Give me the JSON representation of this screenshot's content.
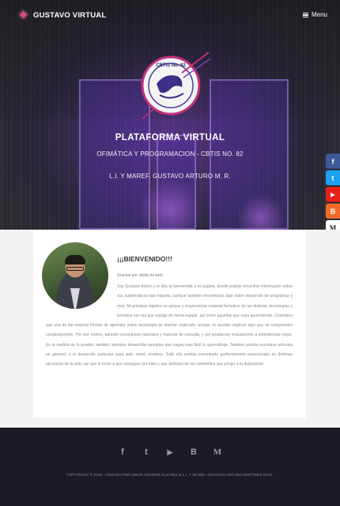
{
  "nav": {
    "brand": "GUSTAVO VIRTUAL",
    "menu_label": "Menu",
    "menu_icon": "hamburger-icon",
    "logo_icon": "star-logo-icon"
  },
  "hero": {
    "emblem_text": "CBTIS No. 82",
    "title": "PLATAFORMA VIRTUAL",
    "subtitle": "OFIMÁTICA Y PROGRAMACION - CBTIS NO. 82",
    "author": "L.I. Y MAREF. GUSTAVO ARTURO M. R."
  },
  "social_sidebar": [
    {
      "name": "facebook-icon",
      "glyph": "f",
      "color": "#3b5998"
    },
    {
      "name": "twitter-icon",
      "glyph": "t",
      "color": "#1da1f2"
    },
    {
      "name": "youtube-icon",
      "glyph": "▶",
      "color": "#e62117"
    },
    {
      "name": "blogger-icon",
      "glyph": "B",
      "color": "#f26a2a"
    },
    {
      "name": "medium-icon",
      "glyph": "M",
      "color": "#ffffff"
    }
  ],
  "about": {
    "welcome": "¡¡¡BIENVENIDO!!!",
    "thanks": "Gracias por visitar mi web",
    "bio": "Soy Gustavo Arturo y te doy la bienvenida a mi página, donde podrás encontrar información sobre sus subtemáticos que imparto, aunque también encontraras algo sobre desarrollo de programas y mas. Mi principal objetivo es apoyar y proporcionar material formativo de las distintas tecnologías y formatos con los que trabajo de forma regular, así como aquellas que vaya aprendiendo. Considero que una de las mejores formas de aprender sobre tecnología es intentar explicarlo, porque no pueden explicar algo que no comprendes completamente. Por ese motivo, también encontraras tutoriales y material de consulta, y así ayudarnos mutuamente a entendernas mejor. En la medida de lo posible, también intentare desarrollar ejemplos que hagan mas fácil tu aprendizaje. También podrás encontrar artículos en general, o el desarrollo particular para web, móvil, etcétera. Todo ello podrás encontrarlo perfectamente estructurado en distintas secciones de la web, así que te invito a que navegues por ellas y que disfrutes de los contenidos que pongo a tu disposición."
  },
  "footer": {
    "icons": [
      {
        "name": "facebook-icon",
        "glyph": "f"
      },
      {
        "name": "twitter-icon",
        "glyph": "t"
      },
      {
        "name": "youtube-icon",
        "glyph": "▶"
      },
      {
        "name": "blogger-icon",
        "glyph": "B"
      },
      {
        "name": "medium-icon",
        "glyph": "M"
      }
    ],
    "copyright": "COPYRIGHT © 2016 · CREADA POR OMAR AGUIRRE ALVAREZ & L.I. Y MAREF. GUSTAVO ARTURO MARTINEZ RIOS."
  }
}
